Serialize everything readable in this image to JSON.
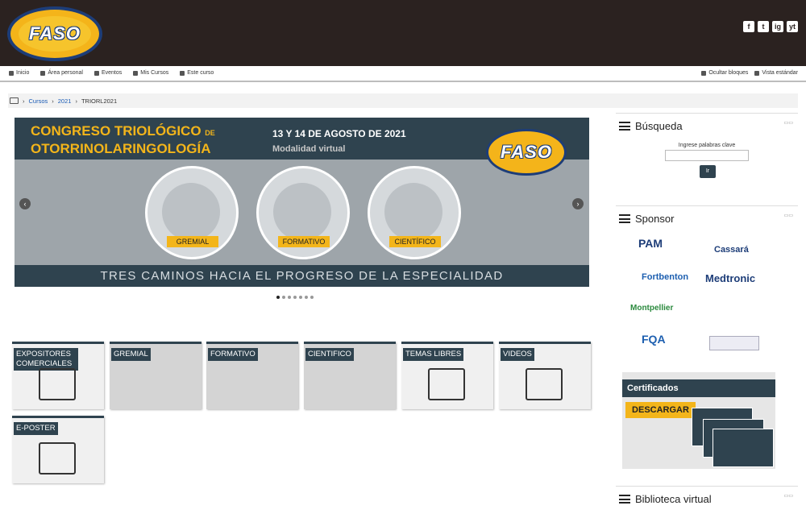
{
  "header": {
    "logo_text": "FASO",
    "social": [
      "f",
      "t",
      "ig",
      "yt"
    ]
  },
  "nav": {
    "left": [
      "Inicio",
      "Área personal",
      "Eventos",
      "Mis Cursos",
      "Este curso"
    ],
    "right": [
      "Ocultar bloques",
      "Vista estándar"
    ]
  },
  "breadcrumb": [
    "Cursos",
    "2021",
    "TRIORL2021"
  ],
  "banner": {
    "title_line1": "CONGRESO TRIOLÓGICO",
    "title_de": "DE",
    "title_line2": "OTORRINOLARINGOLOGÍA",
    "date": "13 Y 14 DE AGOSTO DE 2021",
    "mode": "Modalidad virtual",
    "logo_text": "FASO",
    "circles": [
      "GREMIAL",
      "FORMATIVO",
      "CIENTÍFICO"
    ],
    "tagline": "TRES CAMINOS HACIA EL PROGRESO DE LA ESPECIALIDAD"
  },
  "carousel": {
    "count": 7,
    "active": 0
  },
  "tiles": [
    {
      "label": "EXPOSITORES COMERCIALES",
      "kind": "booth-icon"
    },
    {
      "label": "GREMIAL",
      "kind": "photo"
    },
    {
      "label": "FORMATIVO",
      "kind": "photo"
    },
    {
      "label": "CIENTIFICO",
      "kind": "photo"
    },
    {
      "label": "TEMAS LIBRES",
      "kind": "video-icon"
    },
    {
      "label": "VIDEOS",
      "kind": "video-icon"
    },
    {
      "label": "E-POSTER",
      "kind": "presentation-icon"
    }
  ],
  "search": {
    "title": "Búsqueda",
    "label": "Ingrese palabras clave",
    "button": "Ir",
    "placeholder": ""
  },
  "sponsor": {
    "title": "Sponsor",
    "names": [
      "PAM",
      "Cassará",
      "Fortbenton",
      "Medtronic",
      "Montpellier",
      "FQA"
    ]
  },
  "certificados": {
    "title": "Certificados",
    "button": "DESCARGAR"
  },
  "biblioteca": {
    "title": "Biblioteca virtual"
  },
  "colors": {
    "dark": "#2f434f",
    "accent": "#f3b51a",
    "header": "#2b2220"
  }
}
